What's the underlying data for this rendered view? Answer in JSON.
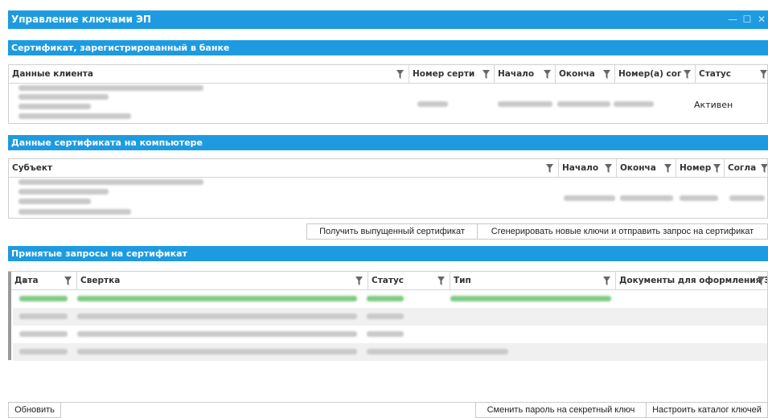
{
  "window": {
    "title": "Управление ключами ЭП",
    "controls": {
      "minimize": "—",
      "maximize": "☐",
      "close": "✕"
    }
  },
  "bank_certificate": {
    "section_title": "Сертификат, зарегистрированный в банке",
    "columns": [
      "Данные клиента",
      "Номер серти",
      "Начало",
      "Оконча",
      "Номер(а) сог",
      "Статус"
    ],
    "rows": [
      {
        "status": "Активен"
      }
    ]
  },
  "local_certificate": {
    "section_title": "Данные сертификата на компьютере",
    "columns": [
      "Субъект",
      "Начало",
      "Оконча",
      "Номер",
      "Согла"
    ],
    "buttons": {
      "get_issued": "Получить выпущенный сертификат",
      "generate_keys": "Сгенерировать новые ключи и отправить запрос на сертификат"
    }
  },
  "requests": {
    "section_title": "Принятые запросы на сертификат",
    "columns": [
      "Дата",
      "Свертка",
      "Статус",
      "Тип",
      "Документы для оформления Э"
    ]
  },
  "footer": {
    "refresh": "Обновить",
    "change_password": "Сменить пароль на секретный ключ",
    "configure_catalog": "Настроить каталог ключей"
  },
  "colors": {
    "accent": "#1e9be0",
    "row_alt": "#f0f0f0",
    "blurred_green": "#7fcb86"
  }
}
